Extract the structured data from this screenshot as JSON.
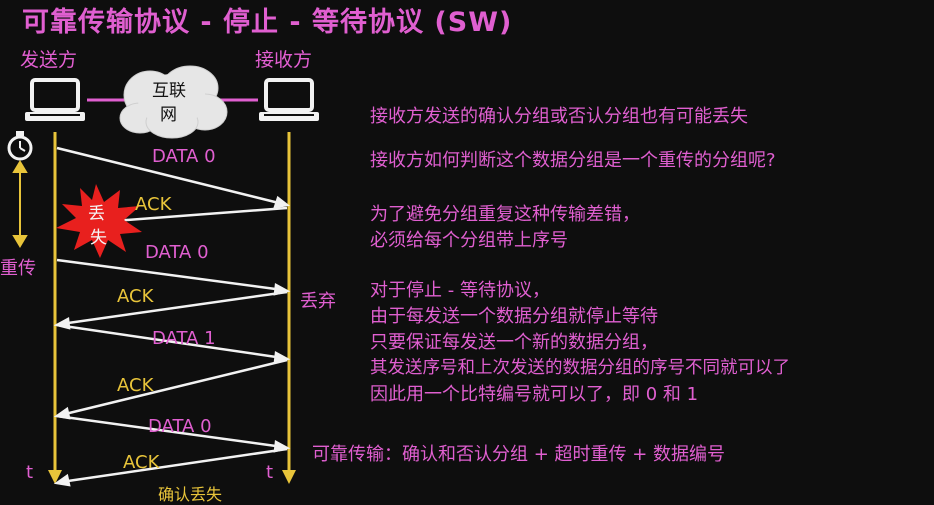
{
  "title": "可靠传输协议 - 停止 - 等待协议 (SW)",
  "parties": {
    "sender": "发送方",
    "receiver": "接收方",
    "network": "互联网"
  },
  "network_lines": [
    "互联",
    "网"
  ],
  "loss_badge": "丢失",
  "loss_badge_lines": [
    "丢",
    "失"
  ],
  "retransmit_label": "重传",
  "discard_label": "丢弃",
  "time_label": "t",
  "confirm_loss_label": "确认丢失",
  "messages": [
    {
      "label": "DATA 0",
      "color": "pink"
    },
    {
      "label": "ACK",
      "color": "yellow"
    },
    {
      "label": "DATA 0",
      "color": "pink"
    },
    {
      "label": "ACK",
      "color": "yellow"
    },
    {
      "label": "DATA 1",
      "color": "pink"
    },
    {
      "label": "ACK",
      "color": "yellow"
    },
    {
      "label": "DATA 0",
      "color": "pink"
    },
    {
      "label": "ACK",
      "color": "yellow"
    }
  ],
  "notes": [
    "接收方发送的确认分组或否认分组也有可能丢失",
    "接收方如何判断这个数据分组是一个重传的分组呢?",
    "为了避免分组重复这种传输差错，",
    "必须给每个分组带上序号",
    "对于停止 - 等待协议，",
    "由于每发送一个数据分组就停止等待",
    "只要保证每发送一个新的数据分组，",
    "其发送序号和上次发送的数据分组的序号不同就可以了",
    "因此用一个比特编号就可以了，即 0 和 1",
    "可靠传输：确认和否认分组 + 超时重传 + 数据编号"
  ],
  "colors": {
    "pink": "#e05fd0",
    "yellow": "#e8c43a",
    "background": "#0e0e0e",
    "burst": "#e8201e"
  }
}
